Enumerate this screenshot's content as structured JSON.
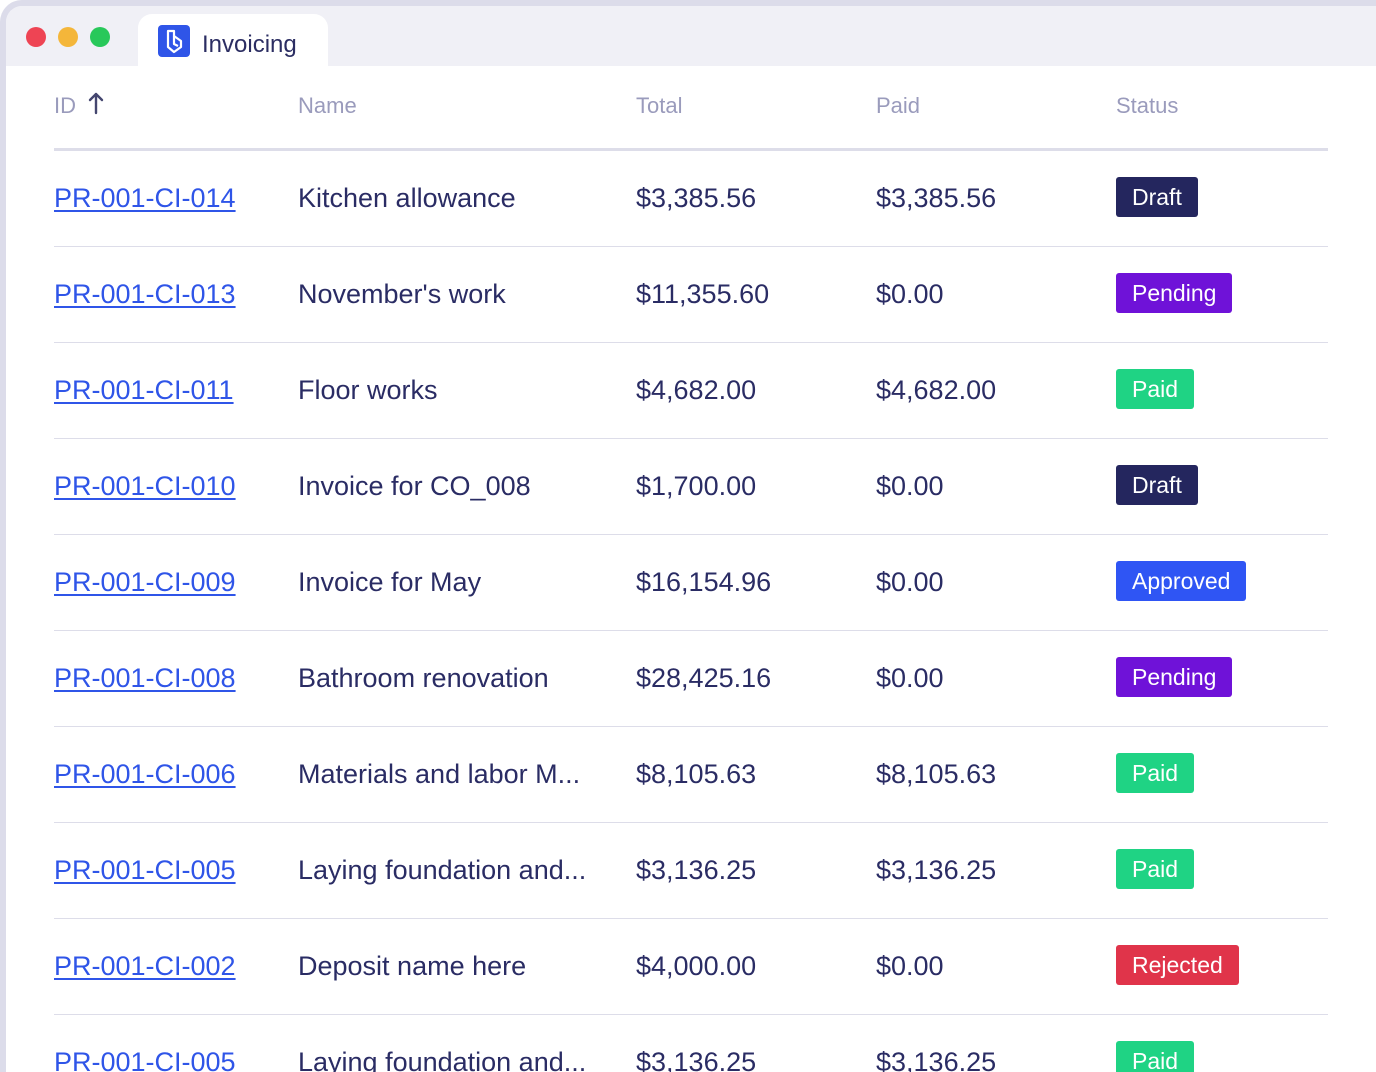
{
  "window": {
    "tab_title": "Invoicing",
    "tab_icon": "app-logo-icon"
  },
  "table": {
    "columns": {
      "id": "ID",
      "name": "Name",
      "total": "Total",
      "paid": "Paid",
      "status": "Status"
    },
    "sort": {
      "column": "ID",
      "direction": "ascending",
      "icon": "arrow-up-icon"
    },
    "rows": [
      {
        "id": "PR-001-CI-014",
        "name": "Kitchen allowance",
        "total": "$3,385.56",
        "paid": "$3,385.56",
        "status": "Draft",
        "status_kind": "draft"
      },
      {
        "id": "PR-001-CI-013",
        "name": "November's work",
        "total": "$11,355.60",
        "paid": "$0.00",
        "status": "Pending",
        "status_kind": "pending"
      },
      {
        "id": "PR-001-CI-011",
        "name": "Floor works",
        "total": "$4,682.00",
        "paid": "$4,682.00",
        "status": "Paid",
        "status_kind": "paid"
      },
      {
        "id": "PR-001-CI-010",
        "name": "Invoice for CO_008",
        "total": "$1,700.00",
        "paid": "$0.00",
        "status": "Draft",
        "status_kind": "draft"
      },
      {
        "id": "PR-001-CI-009",
        "name": "Invoice for May",
        "total": "$16,154.96",
        "paid": "$0.00",
        "status": "Approved",
        "status_kind": "approved"
      },
      {
        "id": "PR-001-CI-008",
        "name": "Bathroom renovation",
        "total": "$28,425.16",
        "paid": "$0.00",
        "status": "Pending",
        "status_kind": "pending"
      },
      {
        "id": "PR-001-CI-006",
        "name": "Materials and labor M...",
        "total": "$8,105.63",
        "paid": "$8,105.63",
        "status": "Paid",
        "status_kind": "paid"
      },
      {
        "id": "PR-001-CI-005",
        "name": "Laying foundation and...",
        "total": "$3,136.25",
        "paid": "$3,136.25",
        "status": "Paid",
        "status_kind": "paid"
      },
      {
        "id": "PR-001-CI-002",
        "name": "Deposit name here",
        "total": "$4,000.00",
        "paid": "$0.00",
        "status": "Rejected",
        "status_kind": "rejected"
      },
      {
        "id": "PR-001-CI-005",
        "name": "Laying foundation and...",
        "total": "$3,136.25",
        "paid": "$3,136.25",
        "status": "Paid",
        "status_kind": "paid"
      }
    ]
  },
  "colors": {
    "draft": "#24265e",
    "pending": "#6f12d8",
    "paid": "#1fd384",
    "approved": "#2f55f4",
    "rejected": "#e0344a",
    "link": "#2f55e8",
    "text": "#2a2c64",
    "header_text": "#9a9bbc"
  }
}
